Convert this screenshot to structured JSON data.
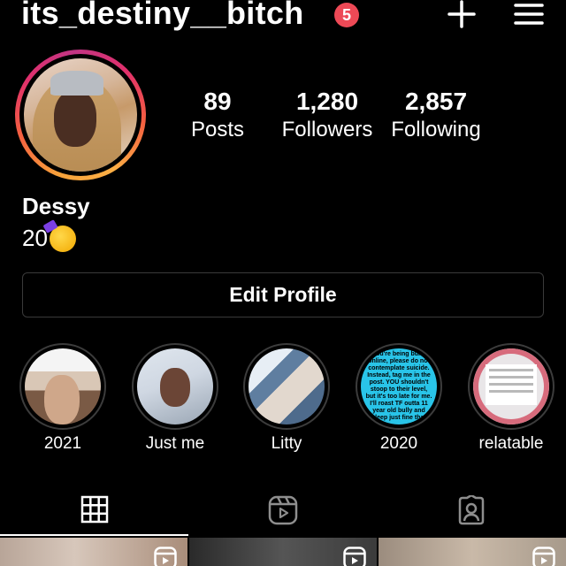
{
  "header": {
    "username": "its_destiny__bitch",
    "notification_count": "5",
    "icons": [
      "plus-icon",
      "menu-icon"
    ]
  },
  "profile": {
    "display_name": "Dessy",
    "bio_text": "20",
    "bio_emoji": "partying-face-emoji"
  },
  "stats": {
    "posts": {
      "value": "89",
      "label": "Posts"
    },
    "followers": {
      "value": "1,280",
      "label": "Followers"
    },
    "following": {
      "value": "2,857",
      "label": "Following"
    }
  },
  "edit_profile_label": "Edit Profile",
  "highlights": [
    {
      "label": "2021"
    },
    {
      "label": "Just me"
    },
    {
      "label": "Litty"
    },
    {
      "label": "2020",
      "cover_text": "If you're being bullied online, please do not contemplate suicide. Instead, tag me in the post. YOU shouldn't stoop to their level, but it's too late for me. I'll roast TF outta 11 year old bully and sleep just fine that"
    },
    {
      "label": "relatable"
    }
  ],
  "tabs": [
    {
      "name": "posts-grid",
      "icon": "grid-icon"
    },
    {
      "name": "reels",
      "icon": "reels-icon"
    },
    {
      "name": "tagged",
      "icon": "tagged-icon"
    }
  ],
  "colors": {
    "background": "#000000",
    "badge": "#ed4956",
    "story_ring": [
      "#fcaf45",
      "#f56040",
      "#e1306c",
      "#c13584"
    ],
    "highlight_border": "#3c3c3c"
  }
}
